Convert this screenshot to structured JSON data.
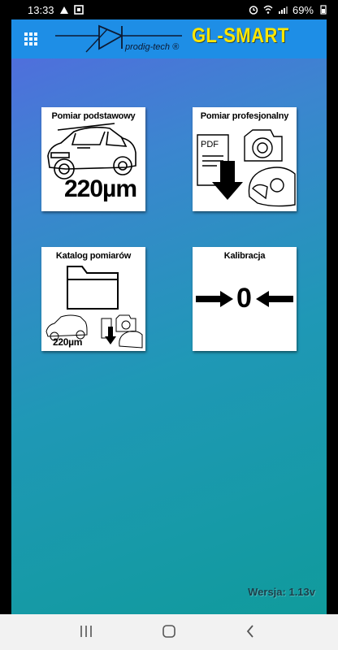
{
  "status_bar": {
    "time": "13:33",
    "battery": "69%"
  },
  "header": {
    "title": "GL-SMART",
    "brand": "prodig-tech ®"
  },
  "tiles": [
    {
      "label": "Pomiar podstawowy",
      "value": "220µm",
      "icon": "car-icon"
    },
    {
      "label": "Pomiar profesjonalny",
      "value": "PDF",
      "icon": "pdf-camera-icon"
    },
    {
      "label": "Katalog pomiarów",
      "value": "220µm",
      "icon": "folder-icon"
    },
    {
      "label": "Kalibracja",
      "value": "0",
      "icon": "calibration-icon"
    }
  ],
  "version": "Wersja: 1.13v",
  "colors": {
    "header": "#1e8ee6",
    "title": "#ffe600",
    "accent": "#109b9c"
  }
}
